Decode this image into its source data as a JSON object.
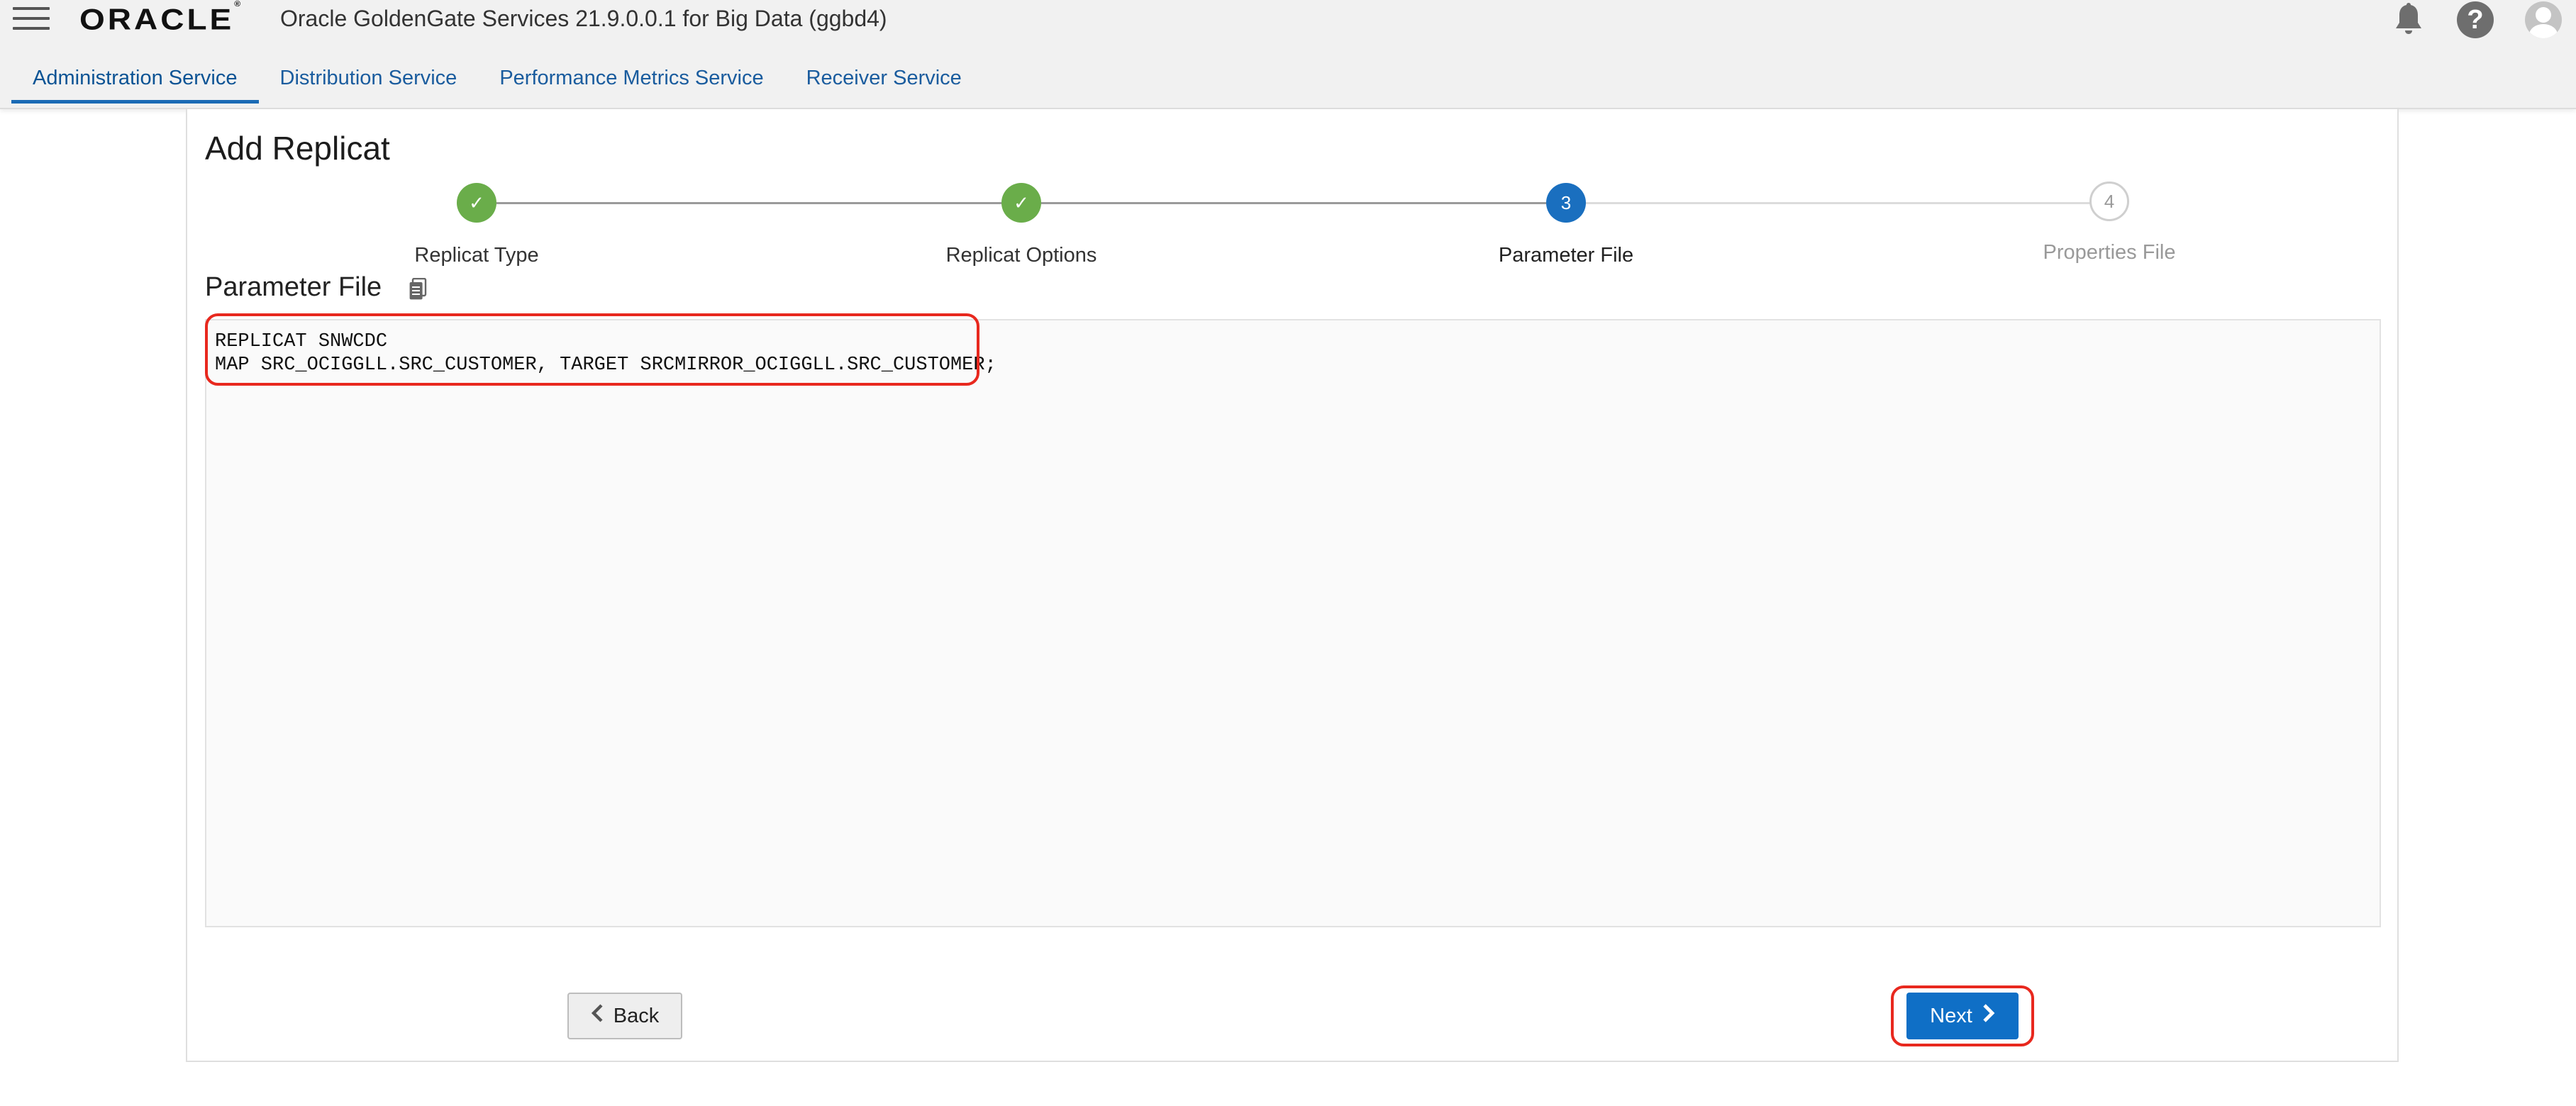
{
  "header": {
    "logo": "ORACLE",
    "logo_mark": "®",
    "title": "Oracle GoldenGate Services 21.9.0.0.1 for Big Data (ggbd4)",
    "icons": [
      "hamburger-menu-icon",
      "bell-icon",
      "help-icon",
      "user-avatar-icon"
    ]
  },
  "tabs": [
    {
      "label": "Administration Service",
      "active": true
    },
    {
      "label": "Distribution Service",
      "active": false
    },
    {
      "label": "Performance Metrics Service",
      "active": false
    },
    {
      "label": "Receiver Service",
      "active": false
    }
  ],
  "page": {
    "title": "Add Replicat"
  },
  "stepper": {
    "steps": [
      {
        "label": "Replicat Type",
        "state": "done",
        "marker": "✓"
      },
      {
        "label": "Replicat Options",
        "state": "done",
        "marker": "✓"
      },
      {
        "label": "Parameter File",
        "state": "current",
        "marker": "3"
      },
      {
        "label": "Properties File",
        "state": "todo",
        "marker": "4"
      }
    ]
  },
  "parameter_file": {
    "title": "Parameter File",
    "icon": "copy-icon",
    "lines": [
      "REPLICAT SNWCDC",
      "MAP SRC_OCIGGLL.SRC_CUSTOMER, TARGET SRCMIRROR_OCIGGLL.SRC_CUSTOMER;"
    ]
  },
  "buttons": {
    "back_label": "Back",
    "next_label": "Next"
  },
  "colors": {
    "accent": "#1a6fbf",
    "done": "#6aad4a",
    "highlight": "#e8281e"
  }
}
